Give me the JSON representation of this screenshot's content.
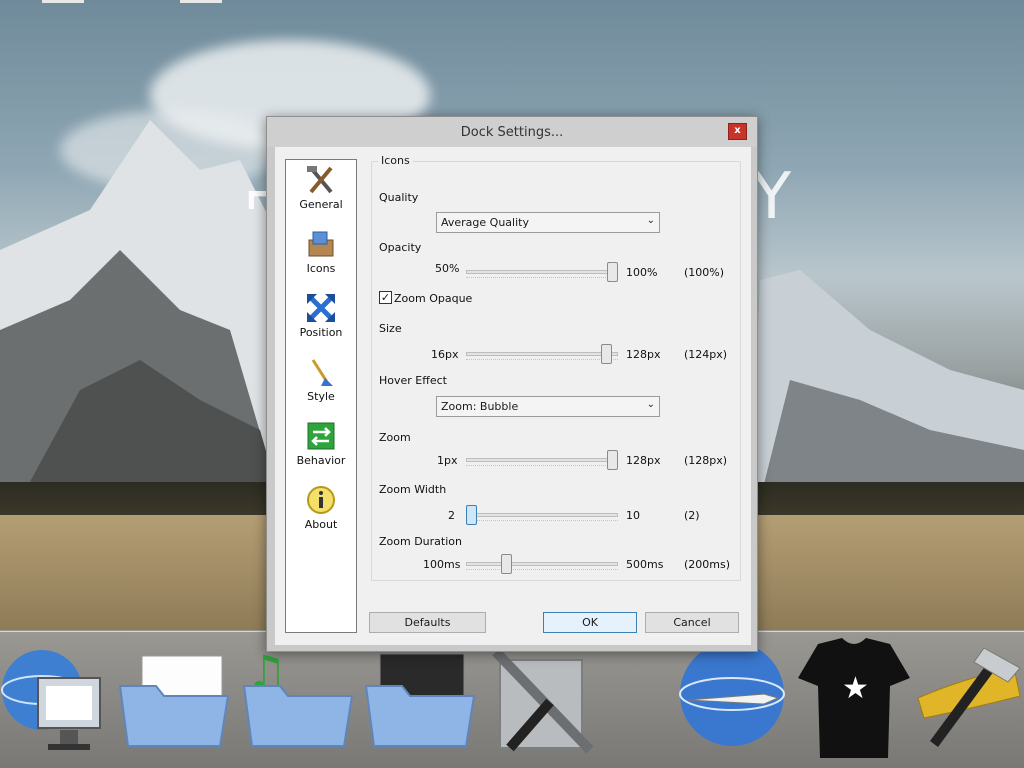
{
  "dialog": {
    "title": "Dock Settings...",
    "close_label": "x"
  },
  "nav": {
    "items": [
      {
        "label": "General",
        "icon": "tools-icon"
      },
      {
        "label": "Icons",
        "icon": "icons-box-icon"
      },
      {
        "label": "Position",
        "icon": "arrows-cross-icon"
      },
      {
        "label": "Style",
        "icon": "paint-brush-icon"
      },
      {
        "label": "Behavior",
        "icon": "green-arrows-icon"
      },
      {
        "label": "About",
        "icon": "info-icon"
      }
    ],
    "selected": "Icons"
  },
  "group": {
    "title": "Icons",
    "quality": {
      "label": "Quality",
      "value": "Average Quality"
    },
    "opacity": {
      "label": "Opacity",
      "min_label": "50%",
      "max_label": "100%",
      "current_label": "(100%)",
      "level": 1.0
    },
    "zoom_opaque": {
      "label": "Zoom Opaque",
      "checked": true
    },
    "size": {
      "label": "Size",
      "min_label": "16px",
      "max_label": "128px",
      "current_label": "(124px)",
      "level": 0.96
    },
    "hover_effect": {
      "label": "Hover Effect",
      "value": "Zoom: Bubble"
    },
    "zoom": {
      "label": "Zoom",
      "min_label": "1px",
      "max_label": "128px",
      "current_label": "(128px)",
      "level": 1.0
    },
    "zoom_width": {
      "label": "Zoom Width",
      "min_label": "2",
      "max_label": "10",
      "current_label": "(2)",
      "level": 0.0
    },
    "zoom_duration": {
      "label": "Zoom Duration",
      "min_label": "100ms",
      "max_label": "500ms",
      "current_label": "(200ms)",
      "level": 0.25
    }
  },
  "buttons": {
    "defaults": "Defaults",
    "ok": "OK",
    "cancel": "Cancel"
  },
  "dock": {
    "items": [
      "globe-computer-icon",
      "documents-folder-icon",
      "music-folder-icon",
      "pictures-folder-icon",
      "system-tools-icon",
      "globe-rocket-icon",
      "tshirt-icon",
      "hammer-wrench-icon"
    ]
  },
  "colors": {
    "close_red": "#c7342a",
    "focus_blue": "#3c7fb1"
  }
}
